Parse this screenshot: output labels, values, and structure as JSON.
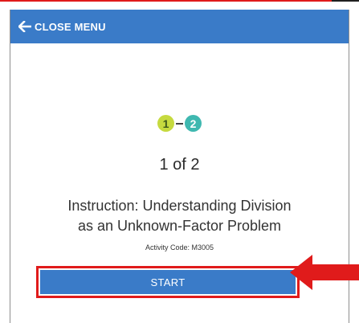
{
  "header": {
    "close_label": "CLOSE MENU",
    "back_icon": "arrow-left-icon"
  },
  "steps": {
    "items": [
      {
        "number": "1",
        "color": "#c6da3f"
      },
      {
        "number": "2",
        "color": "#3fb8b0"
      }
    ]
  },
  "progress": {
    "text": "1 of 2"
  },
  "activity": {
    "title_line1": "Instruction: Understanding Division",
    "title_line2": "as an Unknown-Factor Problem",
    "code_label": "Activity Code: M3005"
  },
  "actions": {
    "start_label": "START"
  },
  "colors": {
    "brand_blue": "#3a7bc8",
    "highlight_red": "#e01b1b"
  }
}
